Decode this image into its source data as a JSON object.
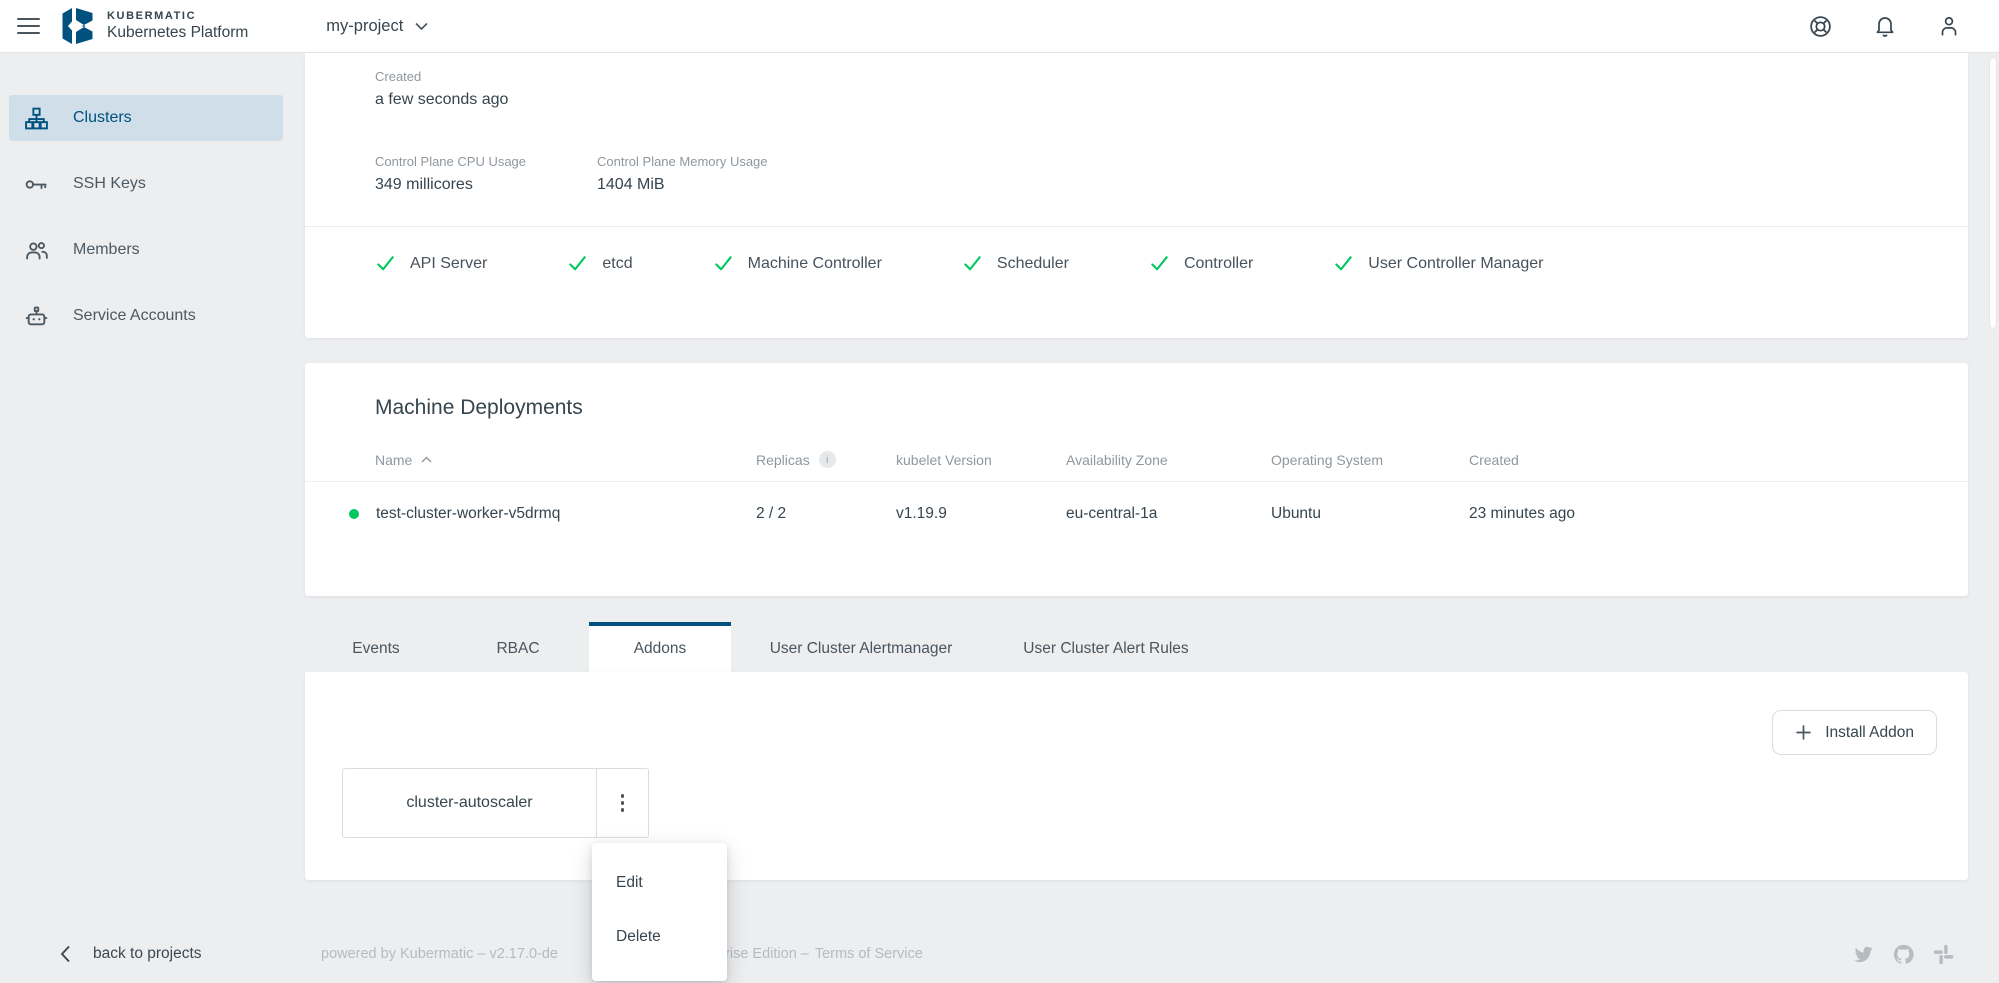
{
  "header": {
    "brand_top": "KUBERMATIC",
    "brand_bottom": "Kubernetes Platform",
    "project_selector": "my-project"
  },
  "sidebar": {
    "items": [
      {
        "label": "Clusters",
        "active": true
      },
      {
        "label": "SSH Keys",
        "active": false
      },
      {
        "label": "Members",
        "active": false
      },
      {
        "label": "Service Accounts",
        "active": false
      }
    ]
  },
  "cluster_overview": {
    "created_label": "Created",
    "created_value": "a few seconds ago",
    "cpu_label": "Control Plane CPU Usage",
    "cpu_value": "349 millicores",
    "memory_label": "Control Plane Memory Usage",
    "memory_value": "1404 MiB",
    "health": [
      "API Server",
      "etcd",
      "Machine Controller",
      "Scheduler",
      "Controller",
      "User Controller Manager"
    ]
  },
  "machine_deployments": {
    "title": "Machine Deployments",
    "columns": [
      "Name",
      "Replicas",
      "kubelet Version",
      "Availability Zone",
      "Operating System",
      "Created"
    ],
    "replicas_info_glyph": "i",
    "rows": [
      {
        "name": "test-cluster-worker-v5drmq",
        "replicas": "2 / 2",
        "kubelet_version": "v1.19.9",
        "availability_zone": "eu-central-1a",
        "operating_system": "Ubuntu",
        "created": "23 minutes ago",
        "status": "healthy"
      }
    ]
  },
  "tabs": [
    {
      "label": "Events",
      "active": false
    },
    {
      "label": "RBAC",
      "active": false
    },
    {
      "label": "Addons",
      "active": true
    },
    {
      "label": "User Cluster Alertmanager",
      "active": false
    },
    {
      "label": "User Cluster Alert Rules",
      "active": false
    }
  ],
  "addons": {
    "install_button": "Install Addon",
    "items": [
      {
        "name": "cluster-autoscaler"
      }
    ],
    "menu": [
      "Edit",
      "Delete"
    ]
  },
  "footer": {
    "back_label": "back to projects",
    "powered_left": "powered by Kubermatic – v2.17.0-de",
    "powered_mid": "nterprise Edition –",
    "terms": "Terms of Service"
  },
  "colors": {
    "accent_blue": "#00517d",
    "active_item_bg": "#cfdee9",
    "success_green": "#00c75f",
    "text_dark": "#36454e",
    "text_muted": "#8f979e",
    "footer_text": "#b4bbc1",
    "page_bg": "#eceef0"
  }
}
